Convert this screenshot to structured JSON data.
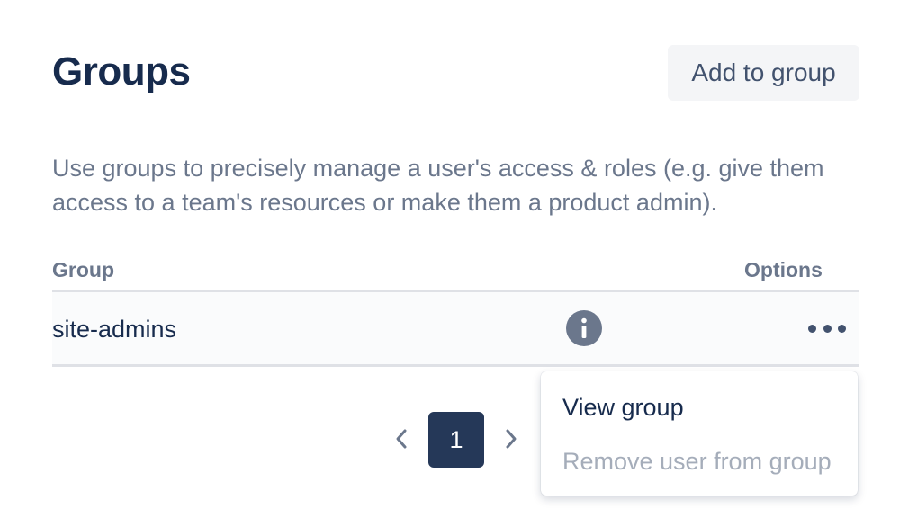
{
  "header": {
    "title": "Groups",
    "add_button_label": "Add to group"
  },
  "description": "Use groups to precisely manage a user's access & roles (e.g. give them access to a team's resources or make them a product admin).",
  "table": {
    "columns": [
      "Group",
      "Options"
    ],
    "rows": [
      {
        "name": "site-admins"
      }
    ]
  },
  "pagination": {
    "current_page": "1"
  },
  "menu": {
    "items": [
      {
        "label": "View group",
        "enabled": true
      },
      {
        "label": "Remove user from group",
        "enabled": false
      }
    ]
  },
  "colors": {
    "title": "#172b4d",
    "muted_text": "#6b778c",
    "disabled_text": "#a5adba",
    "active_page": "#253858",
    "button_bg": "#f4f5f7",
    "divider": "#dfe1e6"
  },
  "icons": {
    "info": "info-icon",
    "more": "more-horizontal-icon",
    "prev": "chevron-left-icon",
    "next": "chevron-right-icon"
  }
}
